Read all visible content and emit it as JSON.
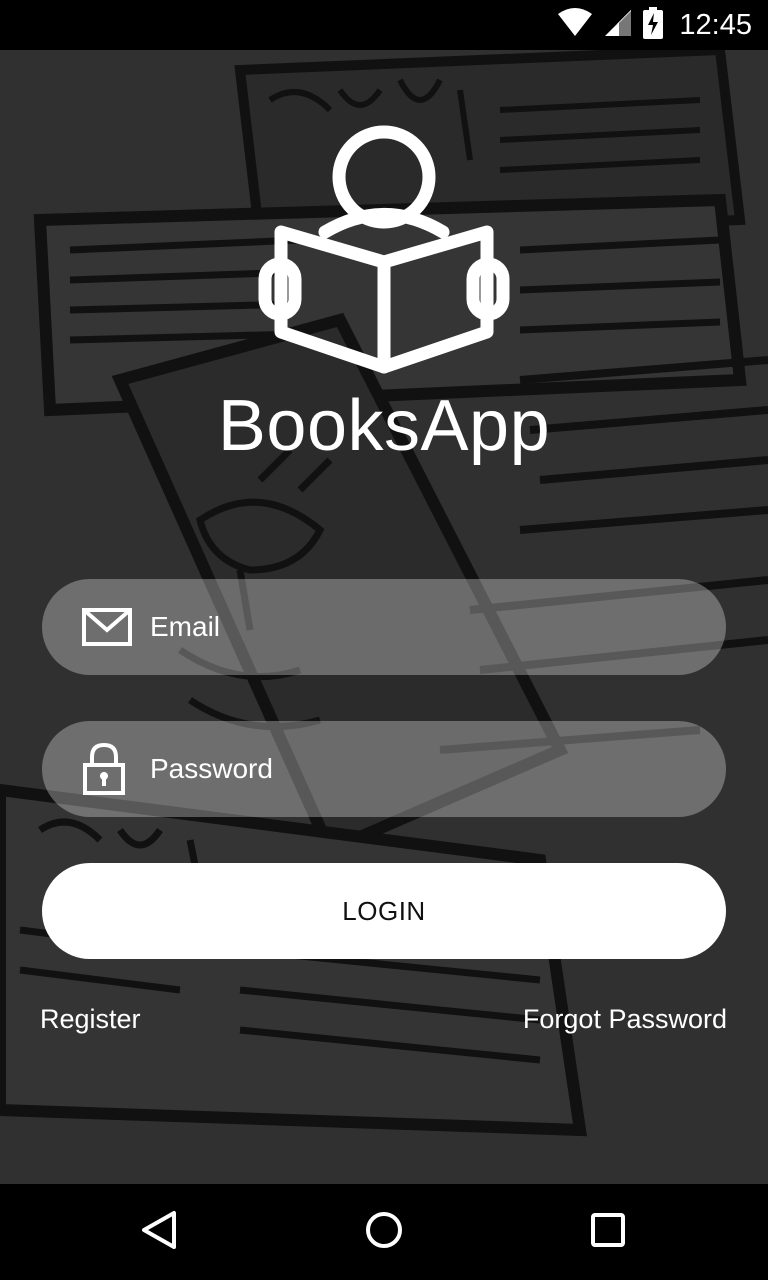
{
  "status_bar": {
    "time": "12:45",
    "icons": [
      "wifi-icon",
      "signal-icon",
      "battery-charging-icon"
    ]
  },
  "app": {
    "title": "BooksApp",
    "logo_icon": "reader-with-book-icon"
  },
  "form": {
    "email": {
      "placeholder": "Email",
      "icon": "envelope-icon"
    },
    "password": {
      "placeholder": "Password",
      "icon": "padlock-icon"
    },
    "login_label": "LOGIN"
  },
  "links": {
    "register": "Register",
    "forgot_password": "Forgot Password"
  },
  "nav_bar": {
    "icons": [
      "back-triangle-icon",
      "home-circle-icon",
      "recents-square-icon"
    ]
  },
  "colors": {
    "background": "#303030",
    "field_fill": "rgba(255,255,255,0.30)",
    "button_fill": "#ffffff",
    "text": "#ffffff"
  }
}
